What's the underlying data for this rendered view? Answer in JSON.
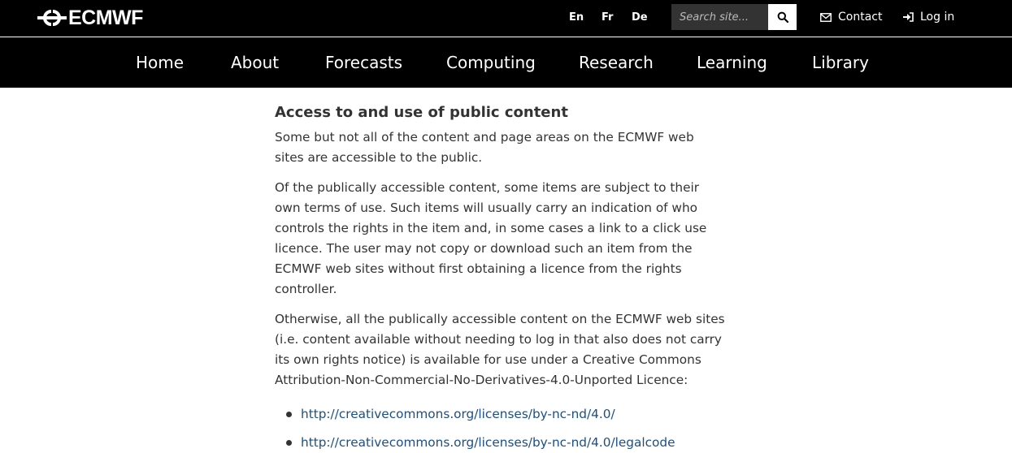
{
  "header": {
    "logo_text": "ECMWF",
    "languages": [
      "En",
      "Fr",
      "De"
    ],
    "search": {
      "placeholder": "Search site..."
    },
    "contact_label": "Contact",
    "login_label": "Log in"
  },
  "nav": {
    "items": [
      "Home",
      "About",
      "Forecasts",
      "Computing",
      "Research",
      "Learning",
      "Library"
    ]
  },
  "content": {
    "heading": "Access to and use of public content",
    "paragraphs": [
      "Some but not all of the content and page areas on the ECMWF web sites are accessible to the public.",
      "Of the publically accessible content, some items are subject to their own terms of use. Such items will usually carry an indication of who controls the rights in the item and, in some cases a link to a click use licence. The user may not copy or download such an item from the ECMWF web sites without first obtaining a licence from the rights controller.",
      "Otherwise, all the publically accessible content on the ECMWF web sites (i.e. content available without needing to log in that also does not carry its own rights notice) is available for use under a Creative Commons Attribution-Non-Commercial-No-Derivatives-4.0-Unported Licence:"
    ],
    "links": [
      "http://creativecommons.org/licenses/by-nc-nd/4.0/",
      "http://creativecommons.org/licenses/by-nc-nd/4.0/legalcode"
    ]
  },
  "icons": {
    "logo": "ecmwf-logo-icon",
    "search": "search-icon",
    "contact": "envelope-icon",
    "login": "sign-in-icon"
  },
  "colors": {
    "header_bg": "#000000",
    "search_bg": "#333333",
    "link": "#1a4f8b",
    "text": "#333333"
  }
}
